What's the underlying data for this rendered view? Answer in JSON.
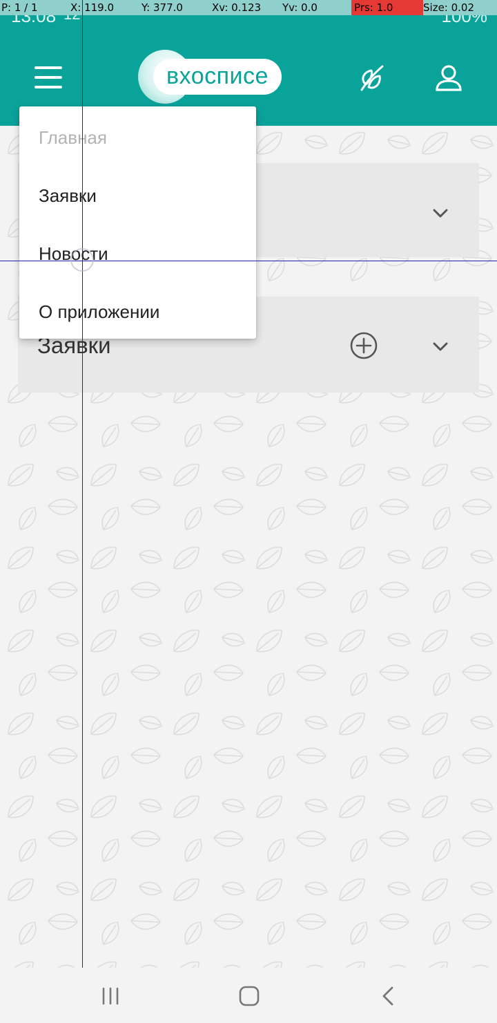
{
  "status_bar": {
    "time": "13:08",
    "extra": "12",
    "battery": "100%"
  },
  "debug": {
    "p": "P: 1 / 1",
    "x": "X: 119.0",
    "y": "Y: 377.0",
    "xv": "Xv: 0.123",
    "yv": "Yv: 0.0",
    "prs": "Prs: 1.0",
    "size": "Size: 0.02"
  },
  "header": {
    "logo_text": "вхосписе",
    "colors": {
      "header_bg": "#0aa39a",
      "icon": "#ffffff"
    }
  },
  "menu": {
    "items": [
      {
        "label": "Главная",
        "disabled": true
      },
      {
        "label": "Заявки",
        "disabled": false
      },
      {
        "label": "Новости",
        "disabled": false
      },
      {
        "label": "О приложении",
        "disabled": false
      }
    ]
  },
  "cards": [
    {
      "title": ""
    },
    {
      "title": "Заявки"
    }
  ],
  "icons": {
    "menu": "hamburger-menu-icon",
    "feather": "feather-icon",
    "user": "user-profile-icon",
    "chevron": "chevron-down-icon",
    "add": "plus-circle-icon",
    "nav_recent": "recent-apps-icon",
    "nav_home": "home-icon",
    "nav_back": "back-icon"
  }
}
